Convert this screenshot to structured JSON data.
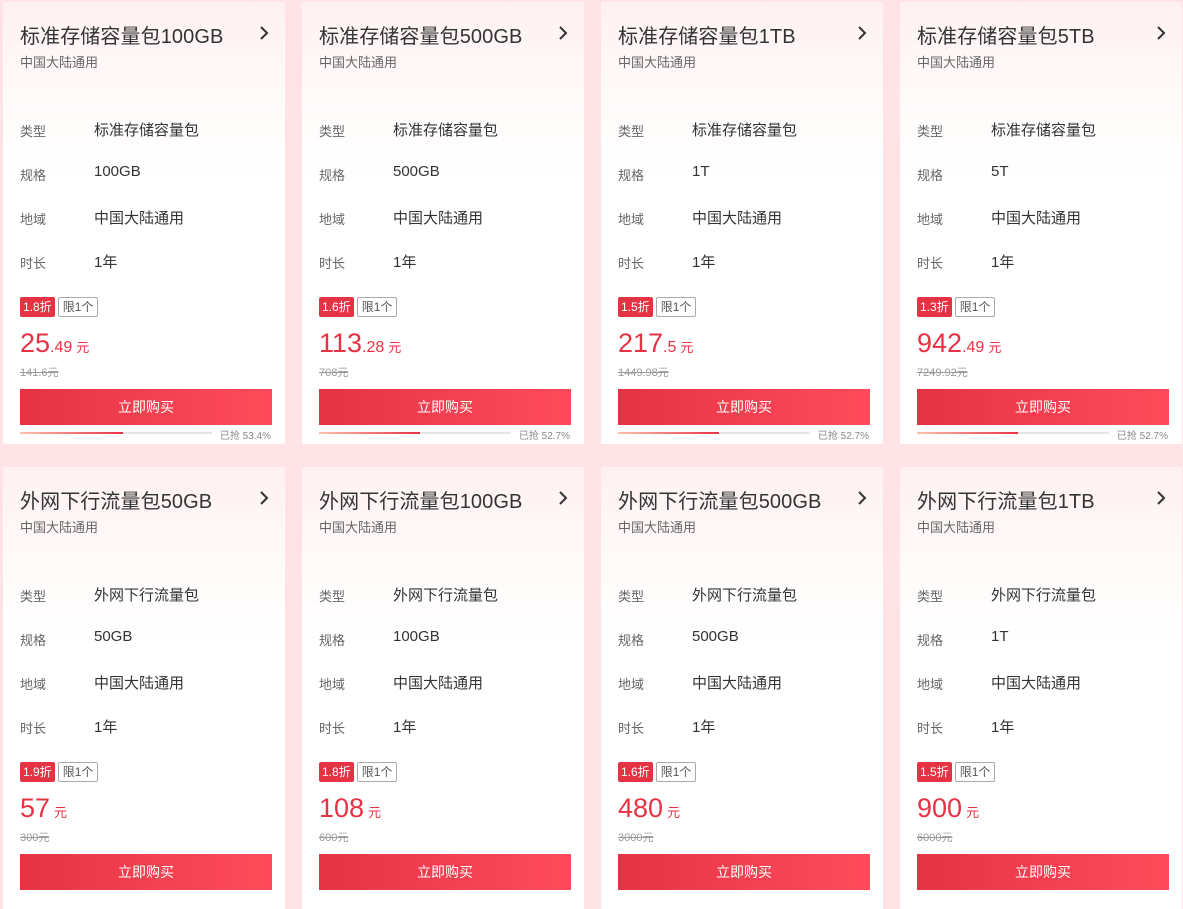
{
  "labels": {
    "type": "类型",
    "spec": "规格",
    "region": "地域",
    "duration": "时长",
    "limit": "限1个",
    "unit": "元",
    "buy": "立即购买"
  },
  "products": [
    {
      "title": "标准存储容量包100GB",
      "subtitle": "中国大陆通用",
      "type": "标准存储容量包",
      "spec": "100GB",
      "region": "中国大陆通用",
      "duration": "1年",
      "discount": "1.8折",
      "price_int": "25",
      "price_dec": ".49",
      "original": "141.6元",
      "sold_text": "已抢 53.4%",
      "sold_fraction": 0.534
    },
    {
      "title": "标准存储容量包500GB",
      "subtitle": "中国大陆通用",
      "type": "标准存储容量包",
      "spec": "500GB",
      "region": "中国大陆通用",
      "duration": "1年",
      "discount": "1.6折",
      "price_int": "113",
      "price_dec": ".28",
      "original": "708元",
      "sold_text": "已抢 52.7%",
      "sold_fraction": 0.527
    },
    {
      "title": "标准存储容量包1TB",
      "subtitle": "中国大陆通用",
      "type": "标准存储容量包",
      "spec": "1T",
      "region": "中国大陆通用",
      "duration": "1年",
      "discount": "1.5折",
      "price_int": "217",
      "price_dec": ".5",
      "original": "1449.98元",
      "sold_text": "已抢 52.7%",
      "sold_fraction": 0.527
    },
    {
      "title": "标准存储容量包5TB",
      "subtitle": "中国大陆通用",
      "type": "标准存储容量包",
      "spec": "5T",
      "region": "中国大陆通用",
      "duration": "1年",
      "discount": "1.3折",
      "price_int": "942",
      "price_dec": ".49",
      "original": "7249.92元",
      "sold_text": "已抢 52.7%",
      "sold_fraction": 0.527
    },
    {
      "title": "外网下行流量包50GB",
      "subtitle": "中国大陆通用",
      "type": "外网下行流量包",
      "spec": "50GB",
      "region": "中国大陆通用",
      "duration": "1年",
      "discount": "1.9折",
      "price_int": "57",
      "price_dec": "",
      "original": "300元"
    },
    {
      "title": "外网下行流量包100GB",
      "subtitle": "中国大陆通用",
      "type": "外网下行流量包",
      "spec": "100GB",
      "region": "中国大陆通用",
      "duration": "1年",
      "discount": "1.8折",
      "price_int": "108",
      "price_dec": "",
      "original": "600元"
    },
    {
      "title": "外网下行流量包500GB",
      "subtitle": "中国大陆通用",
      "type": "外网下行流量包",
      "spec": "500GB",
      "region": "中国大陆通用",
      "duration": "1年",
      "discount": "1.6折",
      "price_int": "480",
      "price_dec": "",
      "original": "3000元"
    },
    {
      "title": "外网下行流量包1TB",
      "subtitle": "中国大陆通用",
      "type": "外网下行流量包",
      "spec": "1T",
      "region": "中国大陆通用",
      "duration": "1年",
      "discount": "1.5折",
      "price_int": "900",
      "price_dec": "",
      "original": "6000元"
    }
  ],
  "colors": {
    "accent": "#e63344",
    "page_background": "#ffe3e6"
  }
}
